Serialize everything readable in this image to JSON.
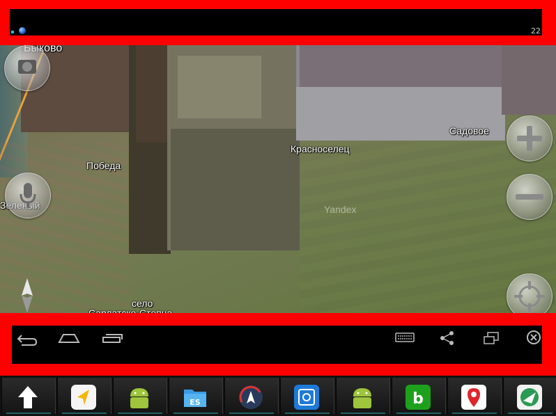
{
  "status_bar": {
    "time": "22"
  },
  "map": {
    "labels": {
      "bykovo": "Быково",
      "pobeda": "Победа",
      "krasnoselets": "Красноселец",
      "sadovoe": "Садовое",
      "zelenyi": "Зеленый",
      "selo": "село",
      "selo_name": "Сарлатско-Степна"
    },
    "watermark": "Yandex"
  },
  "map_controls": {
    "camera": "camera-icon",
    "microphone": "microphone-icon",
    "zoom_in": "plus-icon",
    "zoom_out": "minus-icon",
    "locate": "crosshair-icon",
    "compass": "compass-icon"
  },
  "nav_bar": {
    "back": "back-icon",
    "home": "home-icon",
    "recents": "recents-icon",
    "keyboard": "keyboard-icon",
    "share": "share-icon",
    "window": "window-icon",
    "close": "close-icon"
  },
  "taskbar": {
    "apps": [
      "up-arrow",
      "yandex-navigator",
      "android",
      "es-file-explorer",
      "gps-app",
      "photo-app",
      "android",
      "bt-app",
      "yandex-maps",
      "map-app"
    ]
  },
  "colors": {
    "frame": "#ff0000",
    "accent": "#2a9aa3"
  }
}
